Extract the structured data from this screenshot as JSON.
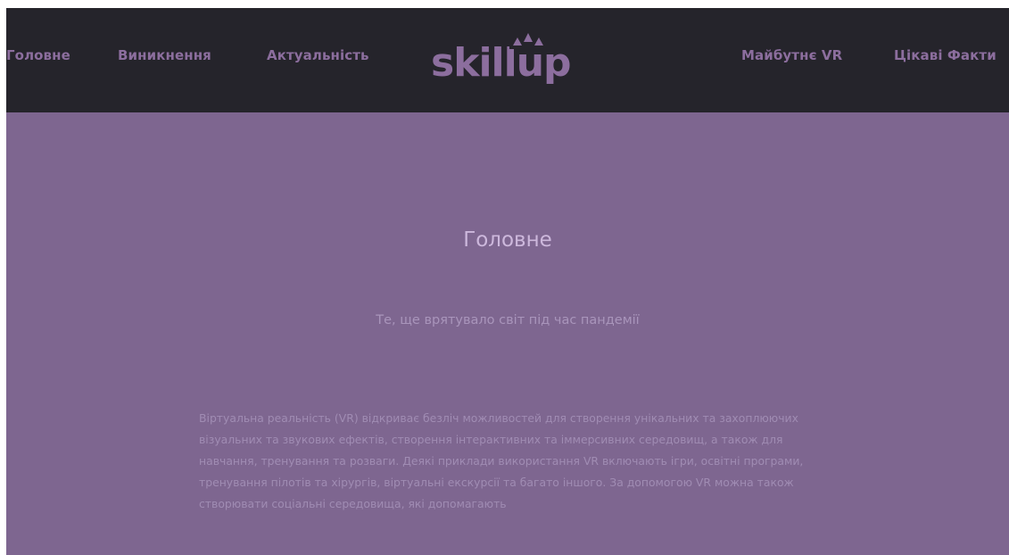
{
  "nav": {
    "left": [
      {
        "label": "Головне"
      },
      {
        "label": "Виникнення"
      },
      {
        "label": "Актуальність"
      }
    ],
    "right": [
      {
        "label": "Майбутнє VR"
      },
      {
        "label": "Цікаві Факти"
      }
    ]
  },
  "logo": {
    "text": "skillup",
    "color": "#8c6e9e"
  },
  "main": {
    "title": "Головне",
    "subtitle": "Те, ще врятувало світ під час пандемії",
    "body": "Віртуальна реальність (VR) відкриває безліч можливостей для створення унікальних та захоплюючих візуальних та звукових ефектів, створення інтерактивних та іммерсивних середовищ, а також для навчання, тренування та розваги. Деякі приклади використання VR включають ігри, освітні програми, тренування пілотів та хірургів, віртуальні екскурсії та багато іншого. За допомогою VR можна також створювати соціальні середовища, які допомагають"
  },
  "colors": {
    "header_bg": "#25242b",
    "accent": "#8c6e9e",
    "hero_bg": "#7e6690",
    "title": "#cdb8dc",
    "text": "#a08cb3"
  }
}
